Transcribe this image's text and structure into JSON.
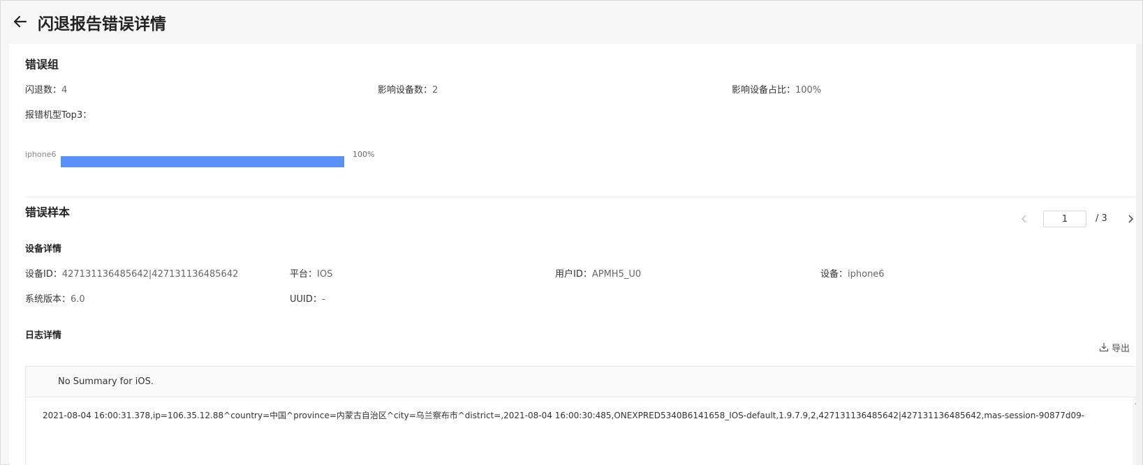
{
  "header": {
    "title": "闪退报告错误详情",
    "back_icon": "arrow-left-icon"
  },
  "error_group": {
    "title": "错误组",
    "crash_count_label": "闪退数：",
    "crash_count": "4",
    "affected_devices_label": "影响设备数：",
    "affected_devices": "2",
    "affected_ratio_label": "影响设备占比：",
    "affected_ratio": "100%",
    "top_models_label": "报错机型Top3：",
    "top_models": [
      {
        "name": "iphone6",
        "percent_label": "100%",
        "fraction": 1.0
      }
    ],
    "bar_color": "#5b8ff9"
  },
  "error_sample": {
    "title": "错误样本",
    "pager": {
      "current": "1",
      "total_text": "/ 3",
      "prev_icon": "chevron-left-icon",
      "next_icon": "chevron-right-icon"
    },
    "device_details": {
      "title": "设备详情",
      "device_id_label": "设备ID：",
      "device_id": "427131136485642|427131136485642",
      "platform_label": "平台：",
      "platform": "IOS",
      "user_id_label": "用户ID：",
      "user_id": "APMH5_U0",
      "device_label": "设备：",
      "device": "iphone6",
      "os_version_label": "系统版本：",
      "os_version": "6.0",
      "uuid_label": "UUID：",
      "uuid": "-"
    },
    "log_details": {
      "title": "日志详情",
      "export_label": "导出",
      "export_icon": "download-icon",
      "summary": "No Summary for iOS.",
      "log_line": "2021-08-04 16:00:31.378,ip=106.35.12.88^country=中国^province=内蒙古自治区^city=乌兰察布市^district=,2021-08-04 16:00:30:485,ONEXPRED5340B6141658_IOS-default,1.9.7.9,2,427131136485642|427131136485642,mas-session-90877d09-"
    }
  }
}
